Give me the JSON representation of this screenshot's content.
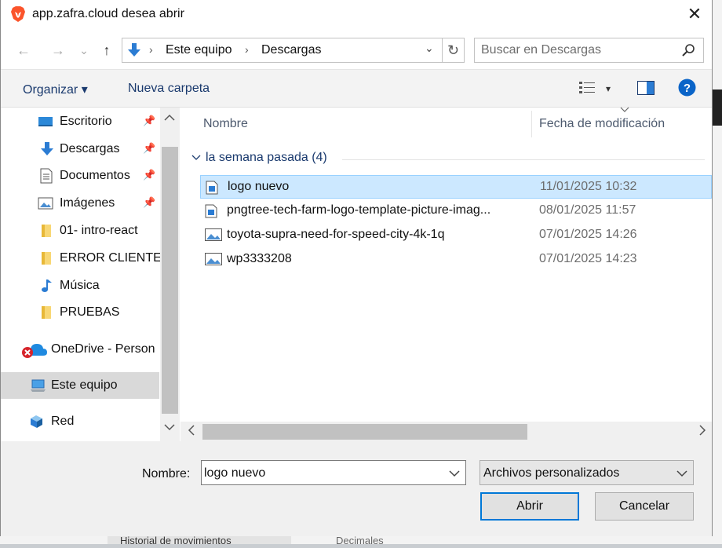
{
  "window": {
    "title": "app.zafra.cloud desea abrir",
    "close_glyph": "✕",
    "app_icon": "brave-lion-icon"
  },
  "navigation": {
    "back_glyph": "←",
    "forward_glyph": "→",
    "recent_glyph": "⌄",
    "up_glyph": "↑",
    "breadcrumbs": [
      "Este equipo",
      "Descargas"
    ],
    "breadcrumb_sep": "›",
    "refresh_glyph": "↻",
    "search_placeholder": "Buscar en Descargas"
  },
  "toolbar": {
    "organize_label": "Organizar ▾",
    "new_folder_label": "Nueva carpeta",
    "help_glyph": "?",
    "view_dd_glyph": "▾"
  },
  "sidebar": {
    "items": [
      {
        "label": "Escritorio",
        "icon": "desktop-icon",
        "pinned": true
      },
      {
        "label": "Descargas",
        "icon": "downloads-icon",
        "pinned": true
      },
      {
        "label": "Documentos",
        "icon": "documents-icon",
        "pinned": true
      },
      {
        "label": "Imágenes",
        "icon": "pictures-icon",
        "pinned": true
      },
      {
        "label": "01- intro-react",
        "icon": "folder-icon",
        "pinned": false
      },
      {
        "label": "ERROR CLIENTE",
        "icon": "folder-icon",
        "pinned": false
      },
      {
        "label": "Música",
        "icon": "music-icon",
        "pinned": false
      },
      {
        "label": "PRUEBAS",
        "icon": "folder-icon",
        "pinned": false
      },
      {
        "label": "OneDrive - Person",
        "icon": "onedrive-icon",
        "pinned": false
      },
      {
        "label": "Este equipo",
        "icon": "this-pc-icon",
        "pinned": false,
        "selected": true
      },
      {
        "label": "Red",
        "icon": "network-icon",
        "pinned": false
      }
    ],
    "pin_glyph": "📌"
  },
  "filelist": {
    "columns": {
      "name": "Nombre",
      "date": "Fecha de modificación"
    },
    "group_label": "la semana pasada (4)",
    "group_chevron": "⌄",
    "rows": [
      {
        "name": "logo nuevo",
        "date": "11/01/2025 10:32",
        "icon": "image-file-icon",
        "selected": true
      },
      {
        "name": "pngtree-tech-farm-logo-template-picture-imag...",
        "date": "08/01/2025 11:57",
        "icon": "image-file-icon"
      },
      {
        "name": "toyota-supra-need-for-speed-city-4k-1q",
        "date": "07/01/2025 14:26",
        "icon": "photo-file-icon"
      },
      {
        "name": "wp3333208",
        "date": "07/01/2025 14:23",
        "icon": "photo-file-icon"
      }
    ]
  },
  "footer": {
    "filename_label": "Nombre:",
    "filename_value": "logo nuevo",
    "filter_value": "Archivos personalizados",
    "open_label": "Abrir",
    "cancel_label": "Cancelar"
  },
  "background": {
    "tab_text": "Historial de movimientos",
    "other_text": "Decimales"
  },
  "colors": {
    "accent": "#0078d7",
    "selection": "#cce8ff",
    "link_text": "#1a3a6e"
  }
}
